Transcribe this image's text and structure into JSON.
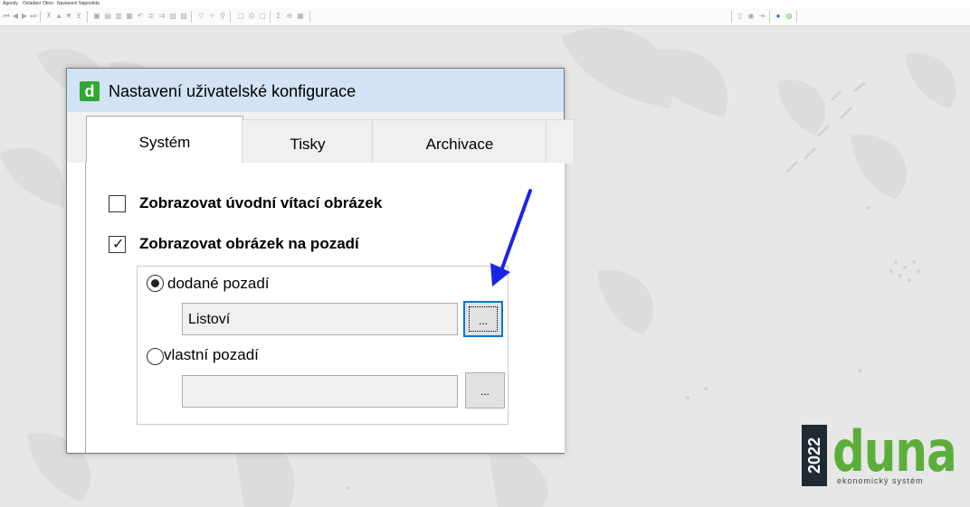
{
  "menubar": {
    "items": [
      "Agendy",
      "Ovládání",
      "Okno",
      "Nastavení",
      "Nápověda"
    ]
  },
  "dialog": {
    "title": "Nastavení uživatelské konfigurace",
    "app_icon_letter": "d",
    "tabs": [
      {
        "label": "Systém",
        "active": true
      },
      {
        "label": "Tisky",
        "active": false
      },
      {
        "label": "Archivace",
        "active": false
      }
    ],
    "options": {
      "welcome_image": {
        "label": "Zobrazovat úvodní vítací obrázek",
        "checked": false
      },
      "background_image": {
        "label": "Zobrazovat obrázek na pozadí",
        "checked": true
      }
    },
    "background": {
      "supplied": {
        "label": "dodané pozadí",
        "selected": true,
        "value": "Listoví",
        "browse_label": "..."
      },
      "custom": {
        "label": "vlastní pozadí",
        "selected": false,
        "value": "",
        "browse_label": "..."
      }
    }
  },
  "logo": {
    "year": "2022",
    "word": "duna",
    "subtitle": "ekonomický systém"
  },
  "colors": {
    "accent_focus": "#0078d7",
    "annotation_arrow": "#1a24e6",
    "logo_green": "#5cae3a",
    "app_icon_green": "#2fa82f"
  }
}
